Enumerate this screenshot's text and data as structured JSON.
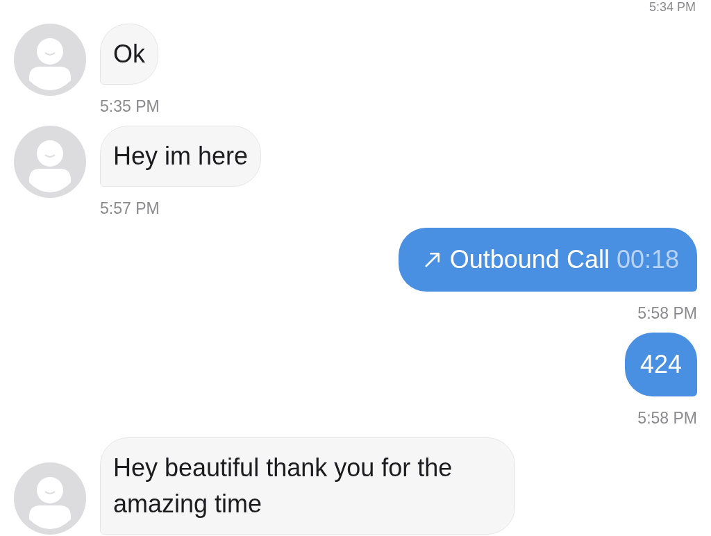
{
  "top_timestamp": "5:34 PM",
  "messages": [
    {
      "kind": "incoming",
      "text": "Ok",
      "time": "5:35 PM"
    },
    {
      "kind": "incoming",
      "text": "Hey im here",
      "time": "5:57 PM"
    },
    {
      "kind": "call",
      "label": "Outbound Call",
      "duration": "00:18",
      "time": "5:58 PM"
    },
    {
      "kind": "outgoing",
      "text": "424",
      "time": "5:58 PM"
    },
    {
      "kind": "incoming",
      "text": "Hey beautiful thank you for the amazing time"
    }
  ]
}
